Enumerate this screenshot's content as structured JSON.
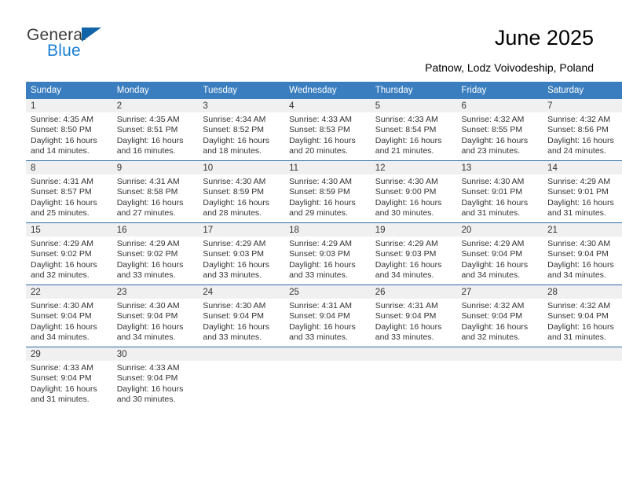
{
  "brand": {
    "name_top": "General",
    "name_bottom": "Blue",
    "accent_color": "#1a7fd4",
    "triangle_color": "#1264a8"
  },
  "header": {
    "title": "June 2025",
    "subtitle": "Patnow, Lodz Voivodeship, Poland"
  },
  "calendar": {
    "header_bg": "#3a7ebf",
    "row_divider_color": "#2e6da4",
    "daynum_band_color": "#f0f0f0",
    "weekday_headers": [
      "Sunday",
      "Monday",
      "Tuesday",
      "Wednesday",
      "Thursday",
      "Friday",
      "Saturday"
    ],
    "weeks": [
      [
        {
          "day": "1",
          "sunrise": "Sunrise: 4:35 AM",
          "sunset": "Sunset: 8:50 PM",
          "daylight_line1": "Daylight: 16 hours",
          "daylight_line2": "and 14 minutes."
        },
        {
          "day": "2",
          "sunrise": "Sunrise: 4:35 AM",
          "sunset": "Sunset: 8:51 PM",
          "daylight_line1": "Daylight: 16 hours",
          "daylight_line2": "and 16 minutes."
        },
        {
          "day": "3",
          "sunrise": "Sunrise: 4:34 AM",
          "sunset": "Sunset: 8:52 PM",
          "daylight_line1": "Daylight: 16 hours",
          "daylight_line2": "and 18 minutes."
        },
        {
          "day": "4",
          "sunrise": "Sunrise: 4:33 AM",
          "sunset": "Sunset: 8:53 PM",
          "daylight_line1": "Daylight: 16 hours",
          "daylight_line2": "and 20 minutes."
        },
        {
          "day": "5",
          "sunrise": "Sunrise: 4:33 AM",
          "sunset": "Sunset: 8:54 PM",
          "daylight_line1": "Daylight: 16 hours",
          "daylight_line2": "and 21 minutes."
        },
        {
          "day": "6",
          "sunrise": "Sunrise: 4:32 AM",
          "sunset": "Sunset: 8:55 PM",
          "daylight_line1": "Daylight: 16 hours",
          "daylight_line2": "and 23 minutes."
        },
        {
          "day": "7",
          "sunrise": "Sunrise: 4:32 AM",
          "sunset": "Sunset: 8:56 PM",
          "daylight_line1": "Daylight: 16 hours",
          "daylight_line2": "and 24 minutes."
        }
      ],
      [
        {
          "day": "8",
          "sunrise": "Sunrise: 4:31 AM",
          "sunset": "Sunset: 8:57 PM",
          "daylight_line1": "Daylight: 16 hours",
          "daylight_line2": "and 25 minutes."
        },
        {
          "day": "9",
          "sunrise": "Sunrise: 4:31 AM",
          "sunset": "Sunset: 8:58 PM",
          "daylight_line1": "Daylight: 16 hours",
          "daylight_line2": "and 27 minutes."
        },
        {
          "day": "10",
          "sunrise": "Sunrise: 4:30 AM",
          "sunset": "Sunset: 8:59 PM",
          "daylight_line1": "Daylight: 16 hours",
          "daylight_line2": "and 28 minutes."
        },
        {
          "day": "11",
          "sunrise": "Sunrise: 4:30 AM",
          "sunset": "Sunset: 8:59 PM",
          "daylight_line1": "Daylight: 16 hours",
          "daylight_line2": "and 29 minutes."
        },
        {
          "day": "12",
          "sunrise": "Sunrise: 4:30 AM",
          "sunset": "Sunset: 9:00 PM",
          "daylight_line1": "Daylight: 16 hours",
          "daylight_line2": "and 30 minutes."
        },
        {
          "day": "13",
          "sunrise": "Sunrise: 4:30 AM",
          "sunset": "Sunset: 9:01 PM",
          "daylight_line1": "Daylight: 16 hours",
          "daylight_line2": "and 31 minutes."
        },
        {
          "day": "14",
          "sunrise": "Sunrise: 4:29 AM",
          "sunset": "Sunset: 9:01 PM",
          "daylight_line1": "Daylight: 16 hours",
          "daylight_line2": "and 31 minutes."
        }
      ],
      [
        {
          "day": "15",
          "sunrise": "Sunrise: 4:29 AM",
          "sunset": "Sunset: 9:02 PM",
          "daylight_line1": "Daylight: 16 hours",
          "daylight_line2": "and 32 minutes."
        },
        {
          "day": "16",
          "sunrise": "Sunrise: 4:29 AM",
          "sunset": "Sunset: 9:02 PM",
          "daylight_line1": "Daylight: 16 hours",
          "daylight_line2": "and 33 minutes."
        },
        {
          "day": "17",
          "sunrise": "Sunrise: 4:29 AM",
          "sunset": "Sunset: 9:03 PM",
          "daylight_line1": "Daylight: 16 hours",
          "daylight_line2": "and 33 minutes."
        },
        {
          "day": "18",
          "sunrise": "Sunrise: 4:29 AM",
          "sunset": "Sunset: 9:03 PM",
          "daylight_line1": "Daylight: 16 hours",
          "daylight_line2": "and 33 minutes."
        },
        {
          "day": "19",
          "sunrise": "Sunrise: 4:29 AM",
          "sunset": "Sunset: 9:03 PM",
          "daylight_line1": "Daylight: 16 hours",
          "daylight_line2": "and 34 minutes."
        },
        {
          "day": "20",
          "sunrise": "Sunrise: 4:29 AM",
          "sunset": "Sunset: 9:04 PM",
          "daylight_line1": "Daylight: 16 hours",
          "daylight_line2": "and 34 minutes."
        },
        {
          "day": "21",
          "sunrise": "Sunrise: 4:30 AM",
          "sunset": "Sunset: 9:04 PM",
          "daylight_line1": "Daylight: 16 hours",
          "daylight_line2": "and 34 minutes."
        }
      ],
      [
        {
          "day": "22",
          "sunrise": "Sunrise: 4:30 AM",
          "sunset": "Sunset: 9:04 PM",
          "daylight_line1": "Daylight: 16 hours",
          "daylight_line2": "and 34 minutes."
        },
        {
          "day": "23",
          "sunrise": "Sunrise: 4:30 AM",
          "sunset": "Sunset: 9:04 PM",
          "daylight_line1": "Daylight: 16 hours",
          "daylight_line2": "and 34 minutes."
        },
        {
          "day": "24",
          "sunrise": "Sunrise: 4:30 AM",
          "sunset": "Sunset: 9:04 PM",
          "daylight_line1": "Daylight: 16 hours",
          "daylight_line2": "and 33 minutes."
        },
        {
          "day": "25",
          "sunrise": "Sunrise: 4:31 AM",
          "sunset": "Sunset: 9:04 PM",
          "daylight_line1": "Daylight: 16 hours",
          "daylight_line2": "and 33 minutes."
        },
        {
          "day": "26",
          "sunrise": "Sunrise: 4:31 AM",
          "sunset": "Sunset: 9:04 PM",
          "daylight_line1": "Daylight: 16 hours",
          "daylight_line2": "and 33 minutes."
        },
        {
          "day": "27",
          "sunrise": "Sunrise: 4:32 AM",
          "sunset": "Sunset: 9:04 PM",
          "daylight_line1": "Daylight: 16 hours",
          "daylight_line2": "and 32 minutes."
        },
        {
          "day": "28",
          "sunrise": "Sunrise: 4:32 AM",
          "sunset": "Sunset: 9:04 PM",
          "daylight_line1": "Daylight: 16 hours",
          "daylight_line2": "and 31 minutes."
        }
      ],
      [
        {
          "day": "29",
          "sunrise": "Sunrise: 4:33 AM",
          "sunset": "Sunset: 9:04 PM",
          "daylight_line1": "Daylight: 16 hours",
          "daylight_line2": "and 31 minutes."
        },
        {
          "day": "30",
          "sunrise": "Sunrise: 4:33 AM",
          "sunset": "Sunset: 9:04 PM",
          "daylight_line1": "Daylight: 16 hours",
          "daylight_line2": "and 30 minutes."
        },
        {
          "day": "",
          "sunrise": "",
          "sunset": "",
          "daylight_line1": "",
          "daylight_line2": ""
        },
        {
          "day": "",
          "sunrise": "",
          "sunset": "",
          "daylight_line1": "",
          "daylight_line2": ""
        },
        {
          "day": "",
          "sunrise": "",
          "sunset": "",
          "daylight_line1": "",
          "daylight_line2": ""
        },
        {
          "day": "",
          "sunrise": "",
          "sunset": "",
          "daylight_line1": "",
          "daylight_line2": ""
        },
        {
          "day": "",
          "sunrise": "",
          "sunset": "",
          "daylight_line1": "",
          "daylight_line2": ""
        }
      ]
    ]
  }
}
